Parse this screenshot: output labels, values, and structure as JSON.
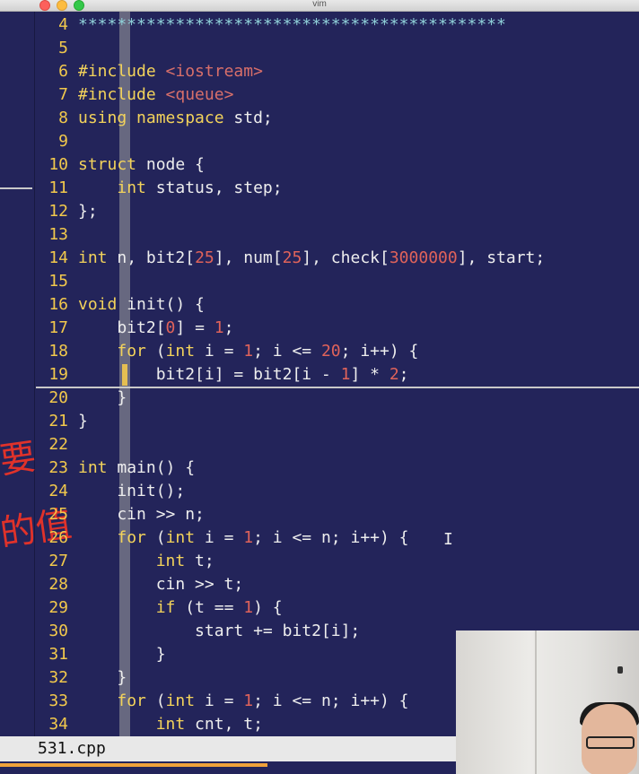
{
  "window": {
    "title": "vim"
  },
  "status": {
    "filename": "531.cpp"
  },
  "annotations": {
    "red_ink_1": "要",
    "red_ink_2": "的值"
  },
  "colors": {
    "background": "#23245a",
    "line_number": "#f2c94c",
    "keyword": "#f3d35b",
    "string": "#d86f6a",
    "number": "#e0635a"
  },
  "lines": [
    {
      "n": "4",
      "code": "********************************************"
    },
    {
      "n": "5",
      "code": ""
    },
    {
      "n": "6",
      "code": "#include <iostream>"
    },
    {
      "n": "7",
      "code": "#include <queue>"
    },
    {
      "n": "8",
      "code": "using namespace std;"
    },
    {
      "n": "9",
      "code": ""
    },
    {
      "n": "10",
      "code": "struct node {"
    },
    {
      "n": "11",
      "code": "    int status, step;"
    },
    {
      "n": "12",
      "code": "};"
    },
    {
      "n": "13",
      "code": ""
    },
    {
      "n": "14",
      "code": "int n, bit2[25], num[25], check[3000000], start;"
    },
    {
      "n": "15",
      "code": ""
    },
    {
      "n": "16",
      "code": "void init() {"
    },
    {
      "n": "17",
      "code": "    bit2[0] = 1;"
    },
    {
      "n": "18",
      "code": "    for (int i = 1; i <= 20; i++) {"
    },
    {
      "n": "19",
      "code": "        bit2[i] = bit2[i - 1] * 2;"
    },
    {
      "n": "20",
      "code": "    }"
    },
    {
      "n": "21",
      "code": "}"
    },
    {
      "n": "22",
      "code": ""
    },
    {
      "n": "23",
      "code": "int main() {"
    },
    {
      "n": "24",
      "code": "    init();"
    },
    {
      "n": "25",
      "code": "    cin >> n;"
    },
    {
      "n": "26",
      "code": "    for (int i = 1; i <= n; i++) {"
    },
    {
      "n": "27",
      "code": "        int t;"
    },
    {
      "n": "28",
      "code": "        cin >> t;"
    },
    {
      "n": "29",
      "code": "        if (t == 1) {"
    },
    {
      "n": "30",
      "code": "            start += bit2[i];"
    },
    {
      "n": "31",
      "code": "        }"
    },
    {
      "n": "32",
      "code": "    }"
    },
    {
      "n": "33",
      "code": "    for (int i = 1; i <= n; i++) {"
    },
    {
      "n": "34",
      "code": "        int cnt, t;"
    }
  ]
}
